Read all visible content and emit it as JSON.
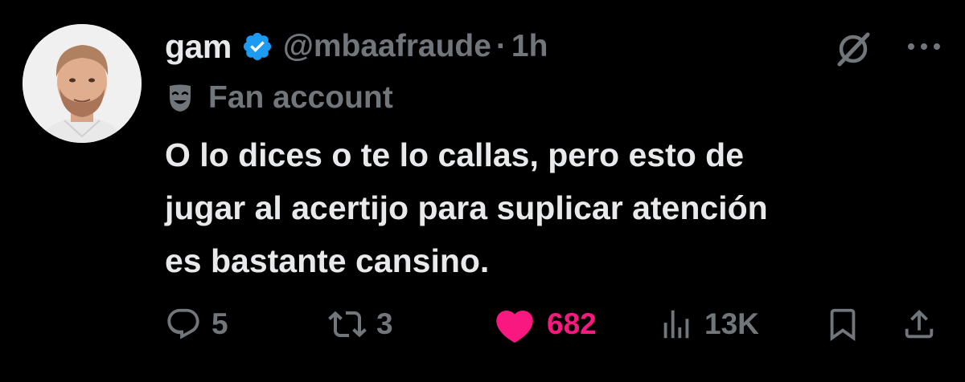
{
  "author": {
    "display_name": "gam",
    "handle": "@mbaafraude",
    "separator": "·",
    "time": "1h",
    "label": "Fan account",
    "avatar_icon": "avatar-photo",
    "verified_icon": "verified-badge-icon"
  },
  "tweet": {
    "text_lines": [
      "O lo dices o te lo callas, pero esto de",
      "jugar al acertijo para suplicar atención",
      "es bastante cansino."
    ]
  },
  "actions": {
    "replies": "5",
    "reposts": "3",
    "likes": "682",
    "views": "13K"
  },
  "colors": {
    "background": "#000000",
    "text": "#e7e9ea",
    "secondary": "#71767b",
    "like": "#f91880",
    "verified": "#1d9bf0"
  }
}
